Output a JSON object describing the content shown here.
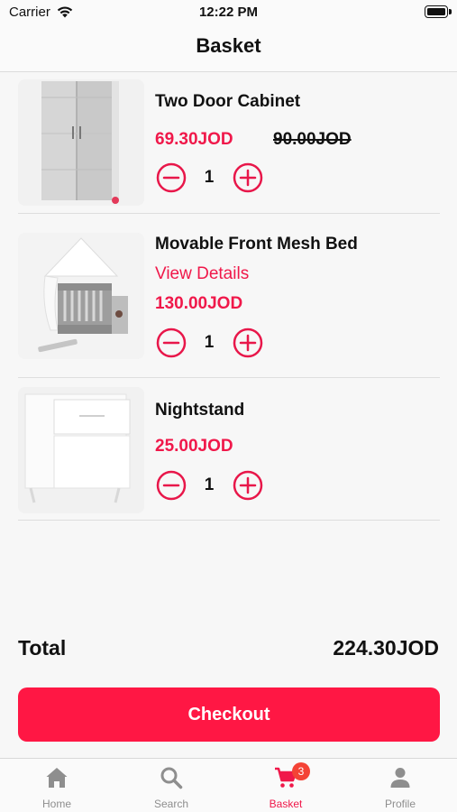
{
  "status_bar": {
    "carrier": "Carrier",
    "time": "12:22 PM"
  },
  "header": {
    "title": "Basket"
  },
  "basket": {
    "items": [
      {
        "name": "Two Door Cabinet",
        "price": "69.30JOD",
        "old_price": "90.00JOD",
        "quantity": "1"
      },
      {
        "name": "Movable Front Mesh Bed",
        "link": "View Details",
        "price": "130.00JOD",
        "quantity": "1"
      },
      {
        "name": "Nightstand",
        "price": "25.00JOD",
        "quantity": "1"
      }
    ]
  },
  "summary": {
    "total_label": "Total",
    "total_value": "224.30JOD"
  },
  "checkout": {
    "label": "Checkout"
  },
  "tabbar": {
    "tabs": [
      {
        "label": "Home",
        "icon": "home-icon"
      },
      {
        "label": "Search",
        "icon": "search-icon"
      },
      {
        "label": "Basket",
        "icon": "cart-icon",
        "badge": "3",
        "active": true
      },
      {
        "label": "Profile",
        "icon": "person-icon"
      }
    ]
  },
  "colors": {
    "accent": "#ff1744",
    "price": "#f0184a",
    "badge": "#f44336",
    "inactive_tab": "#8e8e8e"
  }
}
